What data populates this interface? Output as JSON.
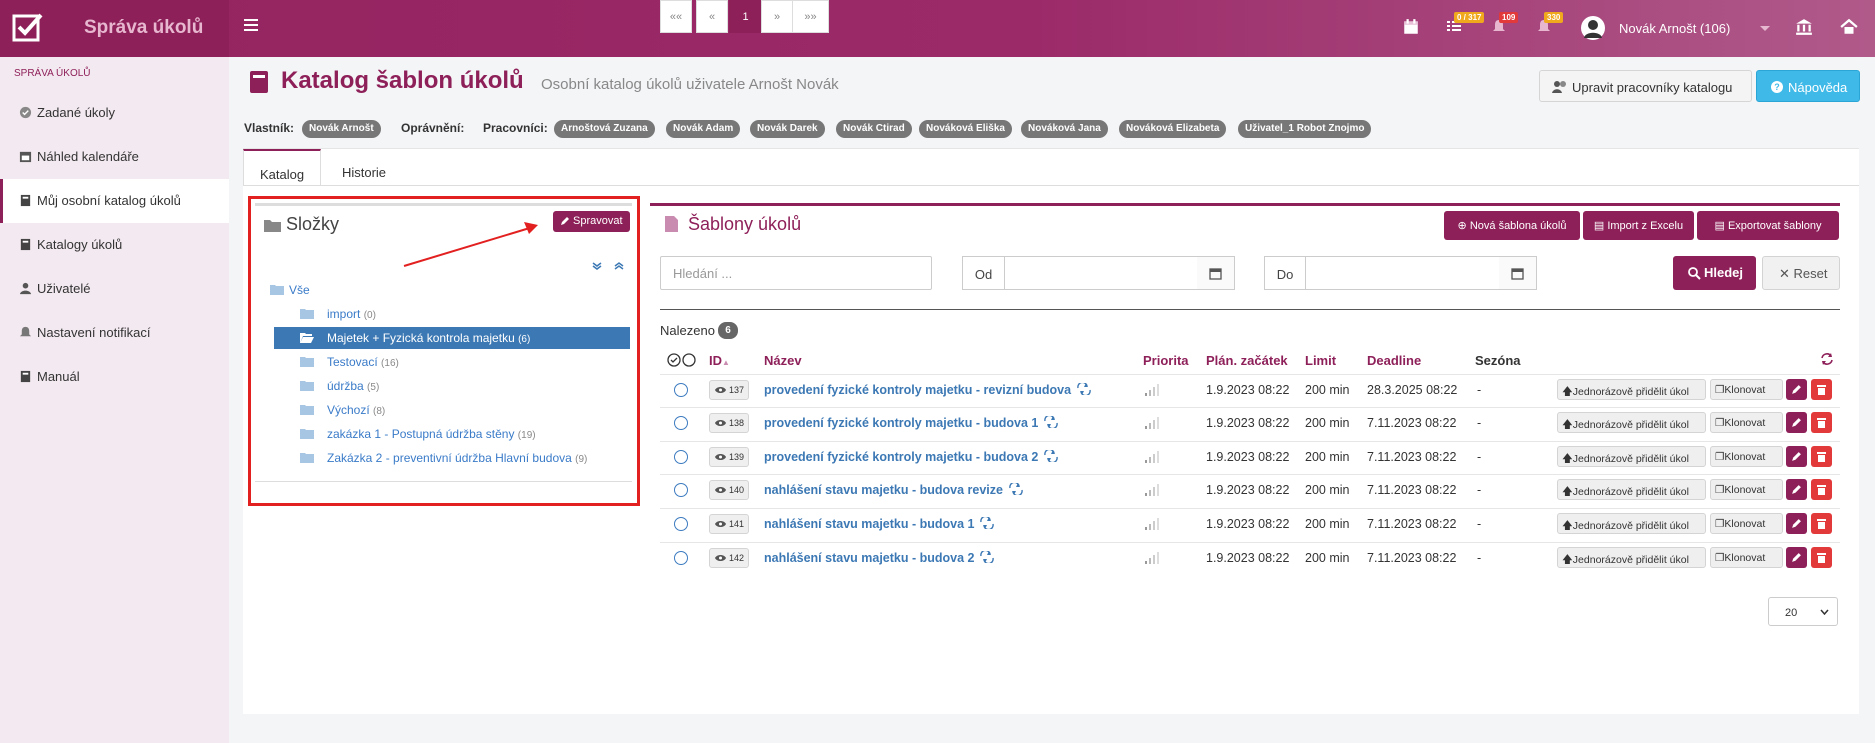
{
  "app": {
    "name": "Správa úkolů"
  },
  "topbar": {
    "badges": {
      "tasks": "0 / 317",
      "alerts": "109",
      "notifications": "330"
    },
    "user_name": "Novák Arnošt (106)"
  },
  "sidebar": {
    "heading": "SPRÁVA ÚKOLŮ",
    "items": [
      {
        "label": "Zadané úkoly",
        "icon": "check-circle-icon"
      },
      {
        "label": "Náhled kalendáře",
        "icon": "calendar-icon"
      },
      {
        "label": "Můj osobní katalog úkolů",
        "icon": "book-icon",
        "active": true
      },
      {
        "label": "Katalogy úkolů",
        "icon": "book-icon"
      },
      {
        "label": "Uživatelé",
        "icon": "users-icon"
      },
      {
        "label": "Nastavení notifikací",
        "icon": "bell-icon"
      },
      {
        "label": "Manuál",
        "icon": "book-icon"
      }
    ]
  },
  "page": {
    "title": "Katalog šablon úkolů",
    "subtitle": "Osobní katalog úkolů uživatele Arnošt Novák",
    "edit_workers_label": "Upravit pracovníky katalogu",
    "help_label": "Nápověda",
    "owner_label": "Vlastník:",
    "owner": "Novák Arnošt",
    "permissions_label": "Oprávnění:",
    "workers_label": "Pracovníci:",
    "workers": [
      "Arnoštová Zuzana",
      "Novák Adam",
      "Novák Darek",
      "Novák Ctirad",
      "Nováková Eliška",
      "Nováková Jana",
      "Nováková Elizabeta",
      "Uživatel_1 Robot Znojmo"
    ]
  },
  "tabs": [
    {
      "label": "Katalog",
      "active": true
    },
    {
      "label": "Historie",
      "active": false
    }
  ],
  "folders": {
    "title": "Složky",
    "manage_label": "Spravovat",
    "root": "Vše",
    "items": [
      {
        "name": "import",
        "count": "(0)"
      },
      {
        "name": "Majetek + Fyzická kontrola majetku",
        "count": "(6)",
        "selected": true
      },
      {
        "name": "Testovací",
        "count": "(16)"
      },
      {
        "name": "údržba",
        "count": "(5)"
      },
      {
        "name": "Výchozí",
        "count": "(8)"
      },
      {
        "name": "zakázka 1 - Postupná údržba stěny",
        "count": "(19)"
      },
      {
        "name": "Zakázka 2 - preventivní údržba Hlavní budova",
        "count": "(9)"
      }
    ]
  },
  "templates": {
    "title": "Šablony úkolů",
    "new_label": "Nová šablona úkolů",
    "import_label": "Import z Excelu",
    "export_label": "Exportovat šablony",
    "search_placeholder": "Hledání ...",
    "from_label": "Od",
    "to_label": "Do",
    "search_label": "Hledej",
    "reset_label": "Reset",
    "found_label": "Nalezeno",
    "found_count": "6",
    "columns": {
      "id": "ID",
      "name": "Název",
      "priority": "Priorita",
      "plan_start": "Plán. začátek",
      "limit": "Limit",
      "deadline": "Deadline",
      "season": "Sezóna"
    },
    "assign_label": "Jednorázově přidělit úkol",
    "clone_label": "Klonovat",
    "rows": [
      {
        "id": "137",
        "name": "provedení fyzické kontroly majetku - revizní budova",
        "plan_start": "1.9.2023 08:22",
        "limit": "200 min",
        "deadline": "28.3.2025 08:22",
        "season": "-"
      },
      {
        "id": "138",
        "name": "provedení fyzické kontroly majetku - budova 1",
        "plan_start": "1.9.2023 08:22",
        "limit": "200 min",
        "deadline": "7.11.2023 08:22",
        "season": "-"
      },
      {
        "id": "139",
        "name": "provedení fyzické kontroly majetku - budova 2",
        "plan_start": "1.9.2023 08:22",
        "limit": "200 min",
        "deadline": "7.11.2023 08:22",
        "season": "-"
      },
      {
        "id": "140",
        "name": "nahlášení stavu majetku - budova revize",
        "plan_start": "1.9.2023 08:22",
        "limit": "200 min",
        "deadline": "7.11.2023 08:22",
        "season": "-"
      },
      {
        "id": "141",
        "name": "nahlášení stavu majetku - budova 1",
        "plan_start": "1.9.2023 08:22",
        "limit": "200 min",
        "deadline": "7.11.2023 08:22",
        "season": "-"
      },
      {
        "id": "142",
        "name": "nahlášení stavu majetku - budova 2",
        "plan_start": "1.9.2023 08:22",
        "limit": "200 min",
        "deadline": "7.11.2023 08:22",
        "season": "-"
      }
    ],
    "pagination": {
      "first": "««",
      "prev": "«",
      "current": "1",
      "next": "»",
      "last": "»»"
    },
    "per_page": "20"
  },
  "colors": {
    "accent": "#8e2059",
    "link": "#3c78b4",
    "help": "#3eb9e8",
    "danger": "#e23a3a"
  }
}
